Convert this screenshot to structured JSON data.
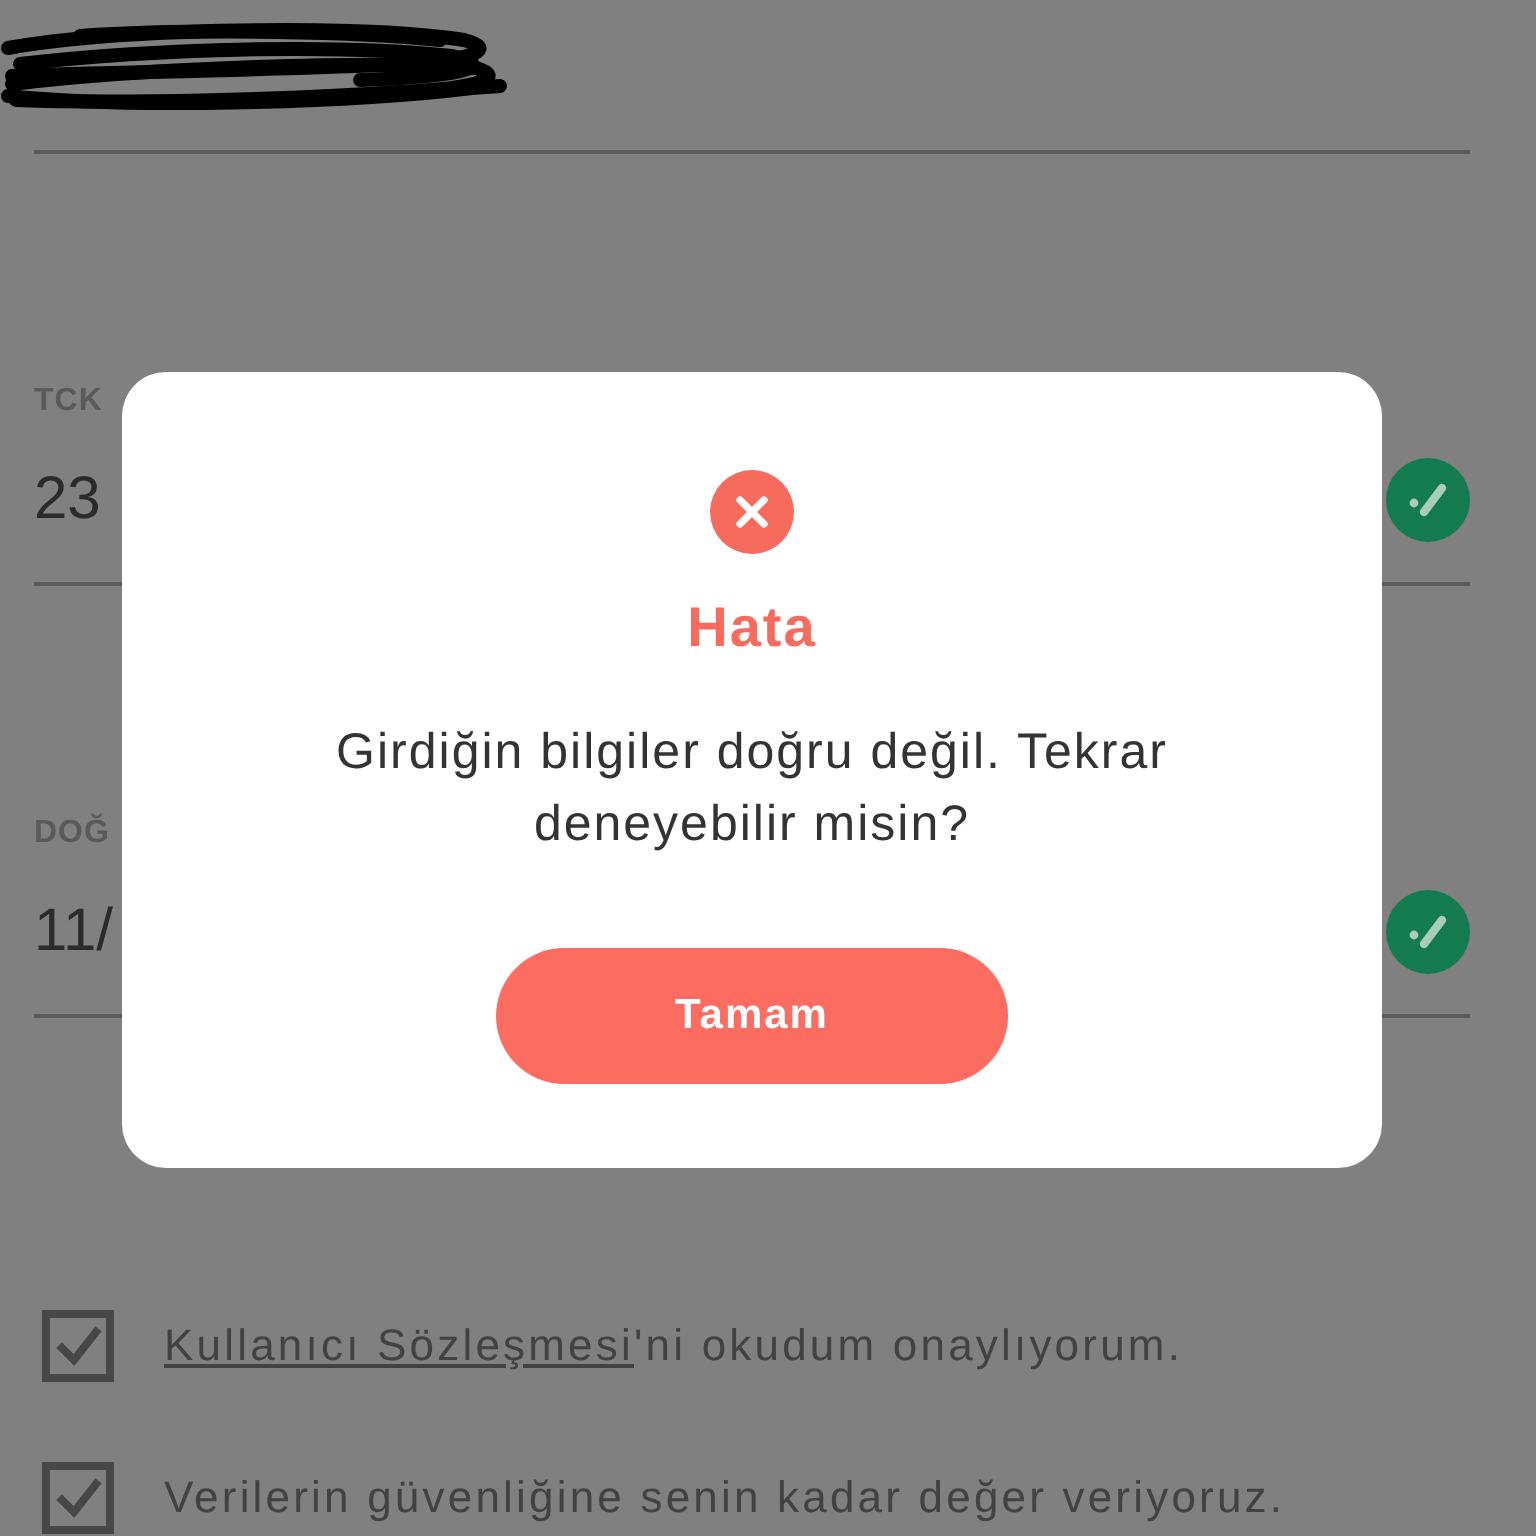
{
  "form": {
    "fields": [
      {
        "label": "TCK",
        "value": "23",
        "valid": true
      },
      {
        "label": "DOĞ",
        "value": "11/",
        "valid": true
      }
    ],
    "agreements": [
      {
        "link": "Kullanıcı Sözleşmesi",
        "text": "'ni okudum onaylıyorum.",
        "checked": true
      },
      {
        "text": "Verilerin güvenliğine senin kadar değer veriyoruz.",
        "checked": true
      }
    ]
  },
  "dialog": {
    "title": "Hata",
    "message": "Girdiğin bilgiler doğru değil. Tekrar deneyebilir misin?",
    "button": "Tamam"
  }
}
